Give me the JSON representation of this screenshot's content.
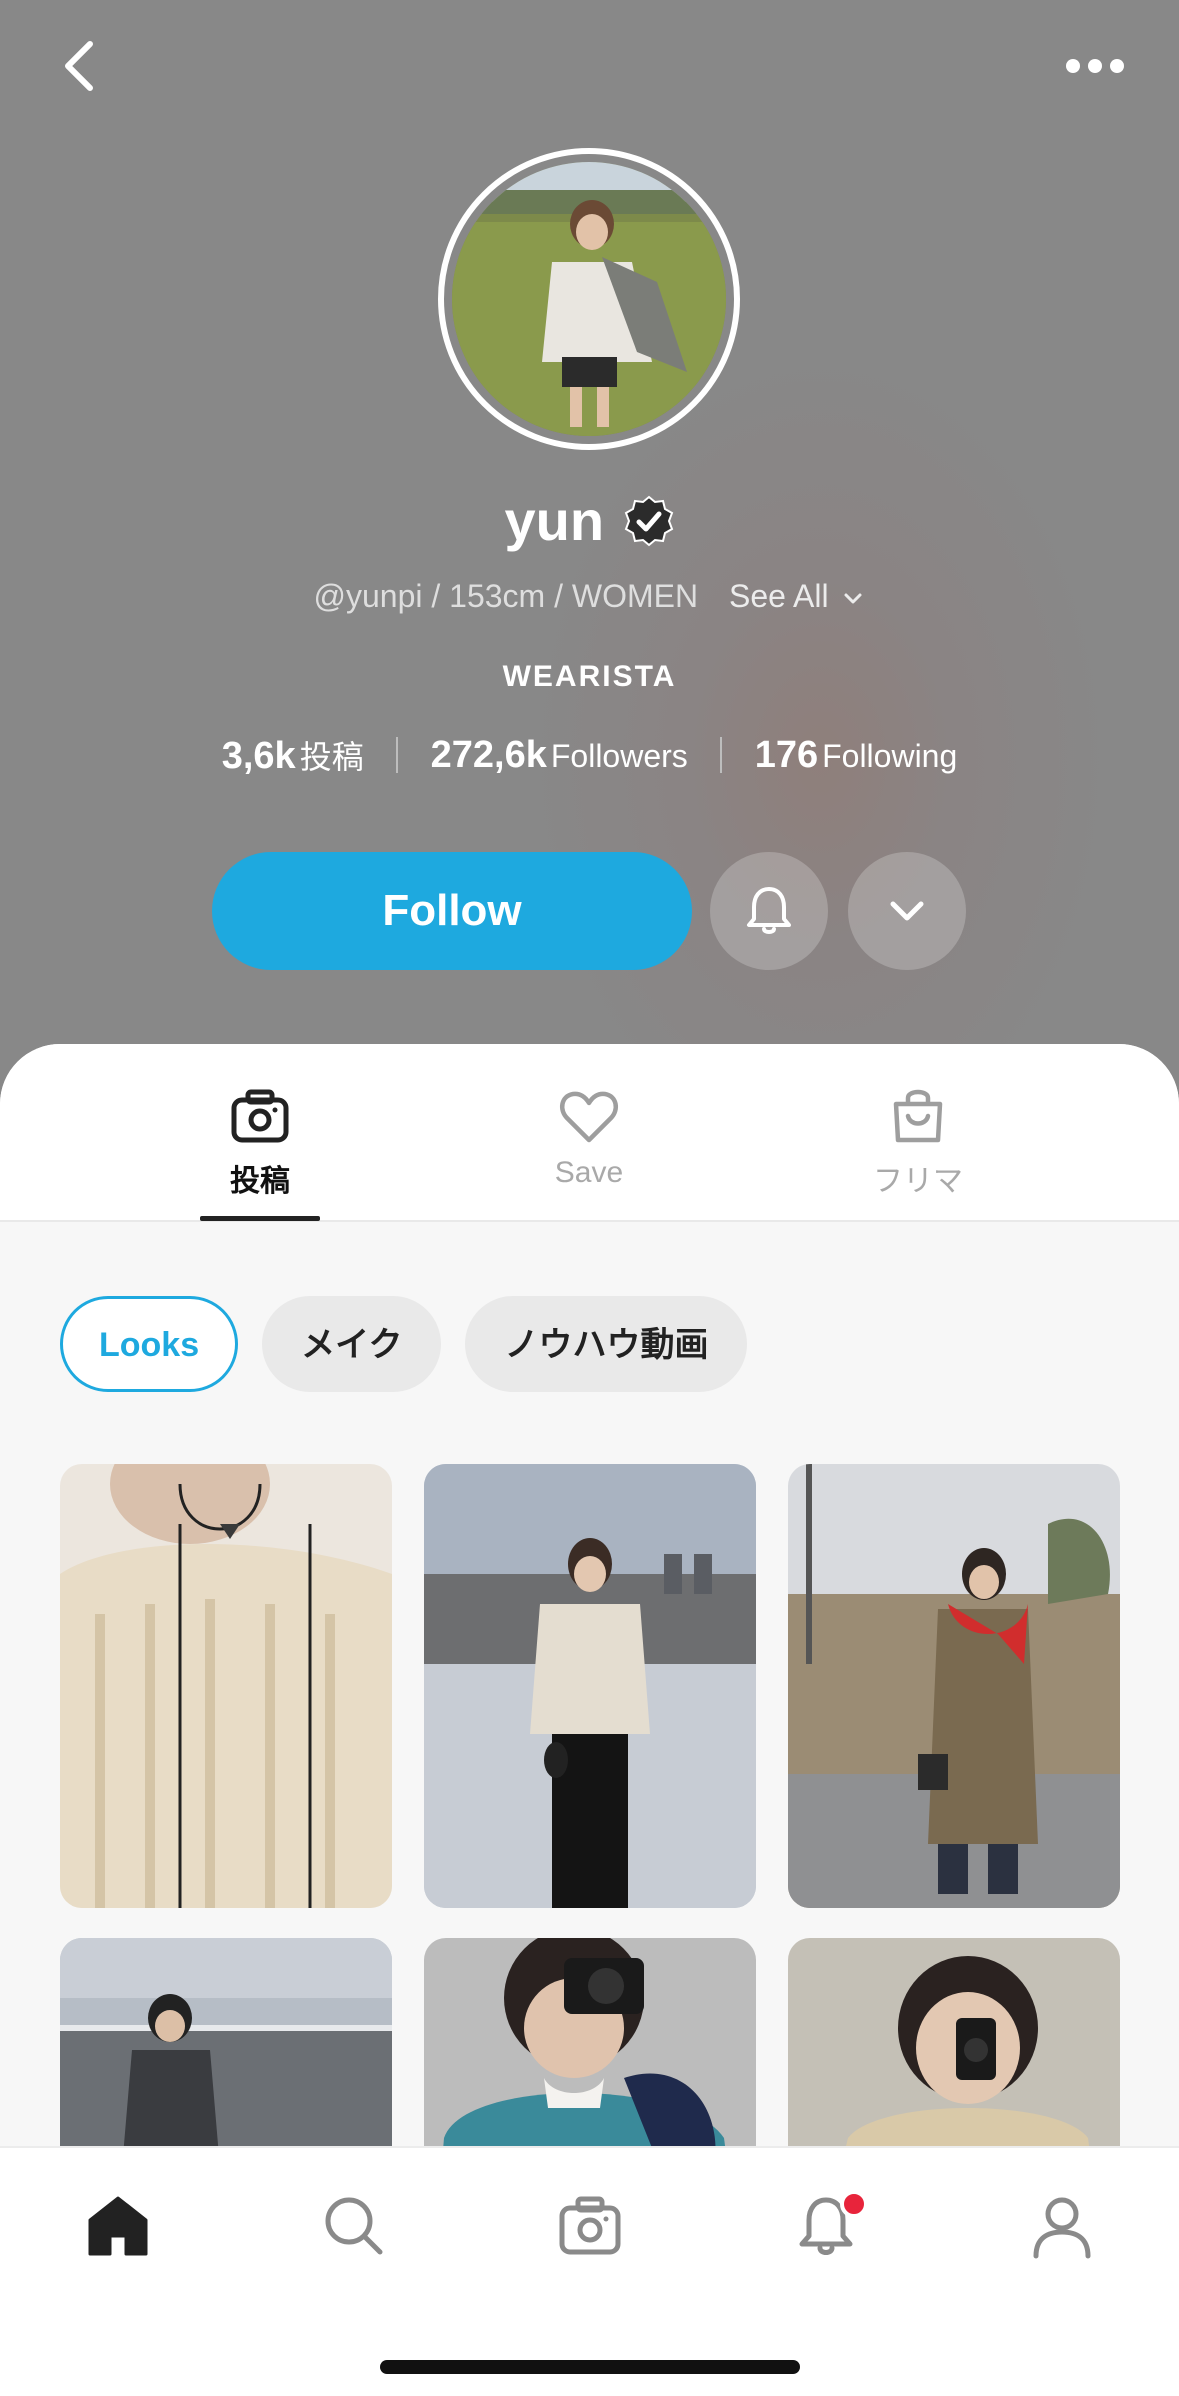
{
  "profile": {
    "name": "yun",
    "meta": "@yunpi / 153cm / WOMEN",
    "see_all": "See All",
    "role": "WEARISTA",
    "stats": [
      {
        "num": "3,6k",
        "label": "投稿"
      },
      {
        "num": "272,6k",
        "label": "Followers"
      },
      {
        "num": "176",
        "label": "Following"
      }
    ],
    "follow_label": "Follow"
  },
  "tabs": [
    {
      "label": "投稿",
      "icon": "camera-icon",
      "active": true
    },
    {
      "label": "Save",
      "icon": "heart-icon",
      "active": false
    },
    {
      "label": "フリマ",
      "icon": "shopping-bag-icon",
      "active": false
    }
  ],
  "chips": [
    {
      "label": "Looks",
      "active": true
    },
    {
      "label": "メイク",
      "active": false
    },
    {
      "label": "ノウハウ動画",
      "active": false
    }
  ],
  "bottom_nav": [
    "home-icon",
    "search-icon",
    "camera-icon",
    "bell-icon",
    "profile-icon"
  ],
  "colors": {
    "accent": "#1ea9df",
    "notification": "#e8243b"
  }
}
